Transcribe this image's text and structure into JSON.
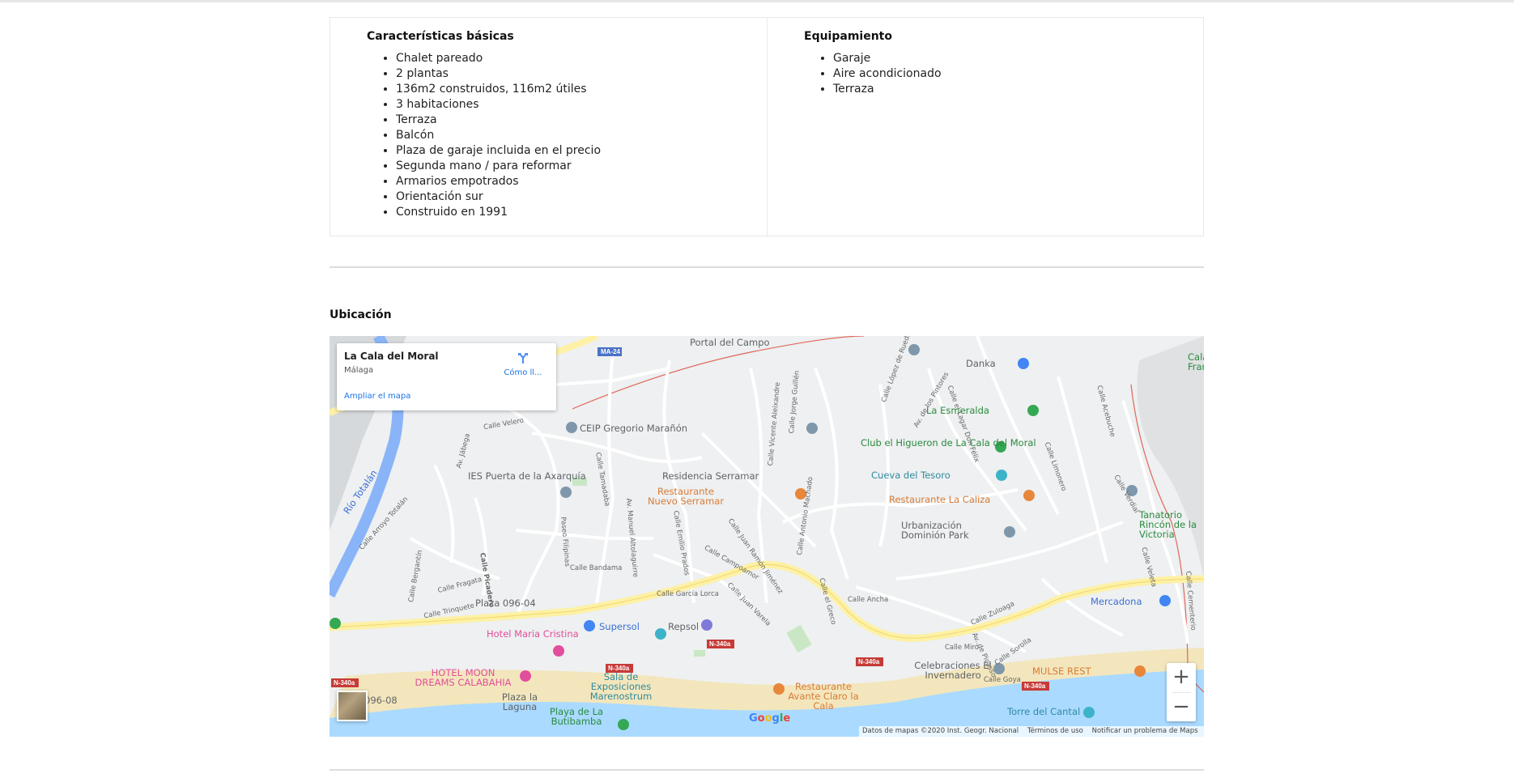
{
  "features": {
    "basic": {
      "title": "Características básicas",
      "items": [
        "Chalet pareado",
        "2 plantas",
        "136m2 construidos, 116m2 útiles",
        "3 habitaciones",
        "Terraza",
        "Balcón",
        "Plaza de garaje incluida en el precio",
        "Segunda mano / para reformar",
        "Armarios empotrados",
        "Orientación sur",
        "Construido en 1991"
      ]
    },
    "equipment": {
      "title": "Equipamiento",
      "items": [
        "Garaje",
        "Aire acondicionado",
        "Terraza"
      ]
    }
  },
  "location": {
    "title": "Ubicación",
    "map": {
      "place_name": "La Cala del Moral",
      "place_city": "Málaga",
      "directions_label": "Cómo ll...",
      "enlarge_label": "Ampliar el mapa",
      "zoom_in": "+",
      "zoom_out": "−",
      "logo": "Google",
      "attribution": [
        "Datos de mapas ©2020 Inst. Geogr. Nacional",
        "Términos de uso",
        "Notificar un problema de Maps"
      ],
      "pois": [
        "Portal del Campo",
        "Danka",
        "La Esmeralda",
        "Club el Higueron de La Cala del Moral",
        "Cueva del Tesoro",
        "Restaurante La Caliza",
        "Urbanización Dominión Park",
        "CEIP Gregorio Marañón",
        "IES Puerta de la Axarquía",
        "Residencia Serramar",
        "Restaurante Nuevo Serramar",
        "Tanatorio Rincón de la Victoria",
        "Mercadona",
        "Supersol",
        "Repsol",
        "Hotel Maria Cristina",
        "HOTEL MOON DREAMS CALABAHIA",
        "Sala de Exposiciones Marenostrum",
        "Restaurante Avante Claro la Cala",
        "Celebraciones El Invernadero",
        "MULSE REST",
        "Torre del Cantal",
        "Playa de La Butibamba",
        "Plaza la Laguna",
        "Plaza 096-04",
        "096-08",
        "Río Totalán",
        "Cala Fran"
      ],
      "streets": [
        "Calle Velero",
        "Av. Jábega",
        "Calle Arroyo Totalán",
        "Calle Bergantín",
        "Calle Fragata",
        "Calle Trinquete",
        "Calle Picadero",
        "Paseo Filipinas",
        "Calle Tamadaba",
        "Av. Manuel Altolaguirre",
        "Calle Emilio Prados",
        "Calle Bandama",
        "Calle García Lorca",
        "Calle Campoamor",
        "Calle Juan Ramón Jiménez",
        "Calle Juan Varela",
        "Calle Antonio Machado",
        "Calle el Greco",
        "Calle Vicente Aleixandre",
        "Calle Jorge Guillén",
        "Calle López de Rueda",
        "Av. de los Pintores",
        "Calle el Lagar Don Félix",
        "Calle Ancha",
        "Calle Zuloaga",
        "Calle Miró",
        "Av. de Picasso",
        "Calle Sorolla",
        "Calle Goya",
        "Calle Limonero",
        "Calle Acebuche",
        "Calle Verdial",
        "Calle Cementerio",
        "Calle Veleta"
      ],
      "road_badges": [
        "MA-24",
        "N-340a",
        "N-340a",
        "N-340a",
        "N-340a",
        "N-340a"
      ]
    }
  }
}
